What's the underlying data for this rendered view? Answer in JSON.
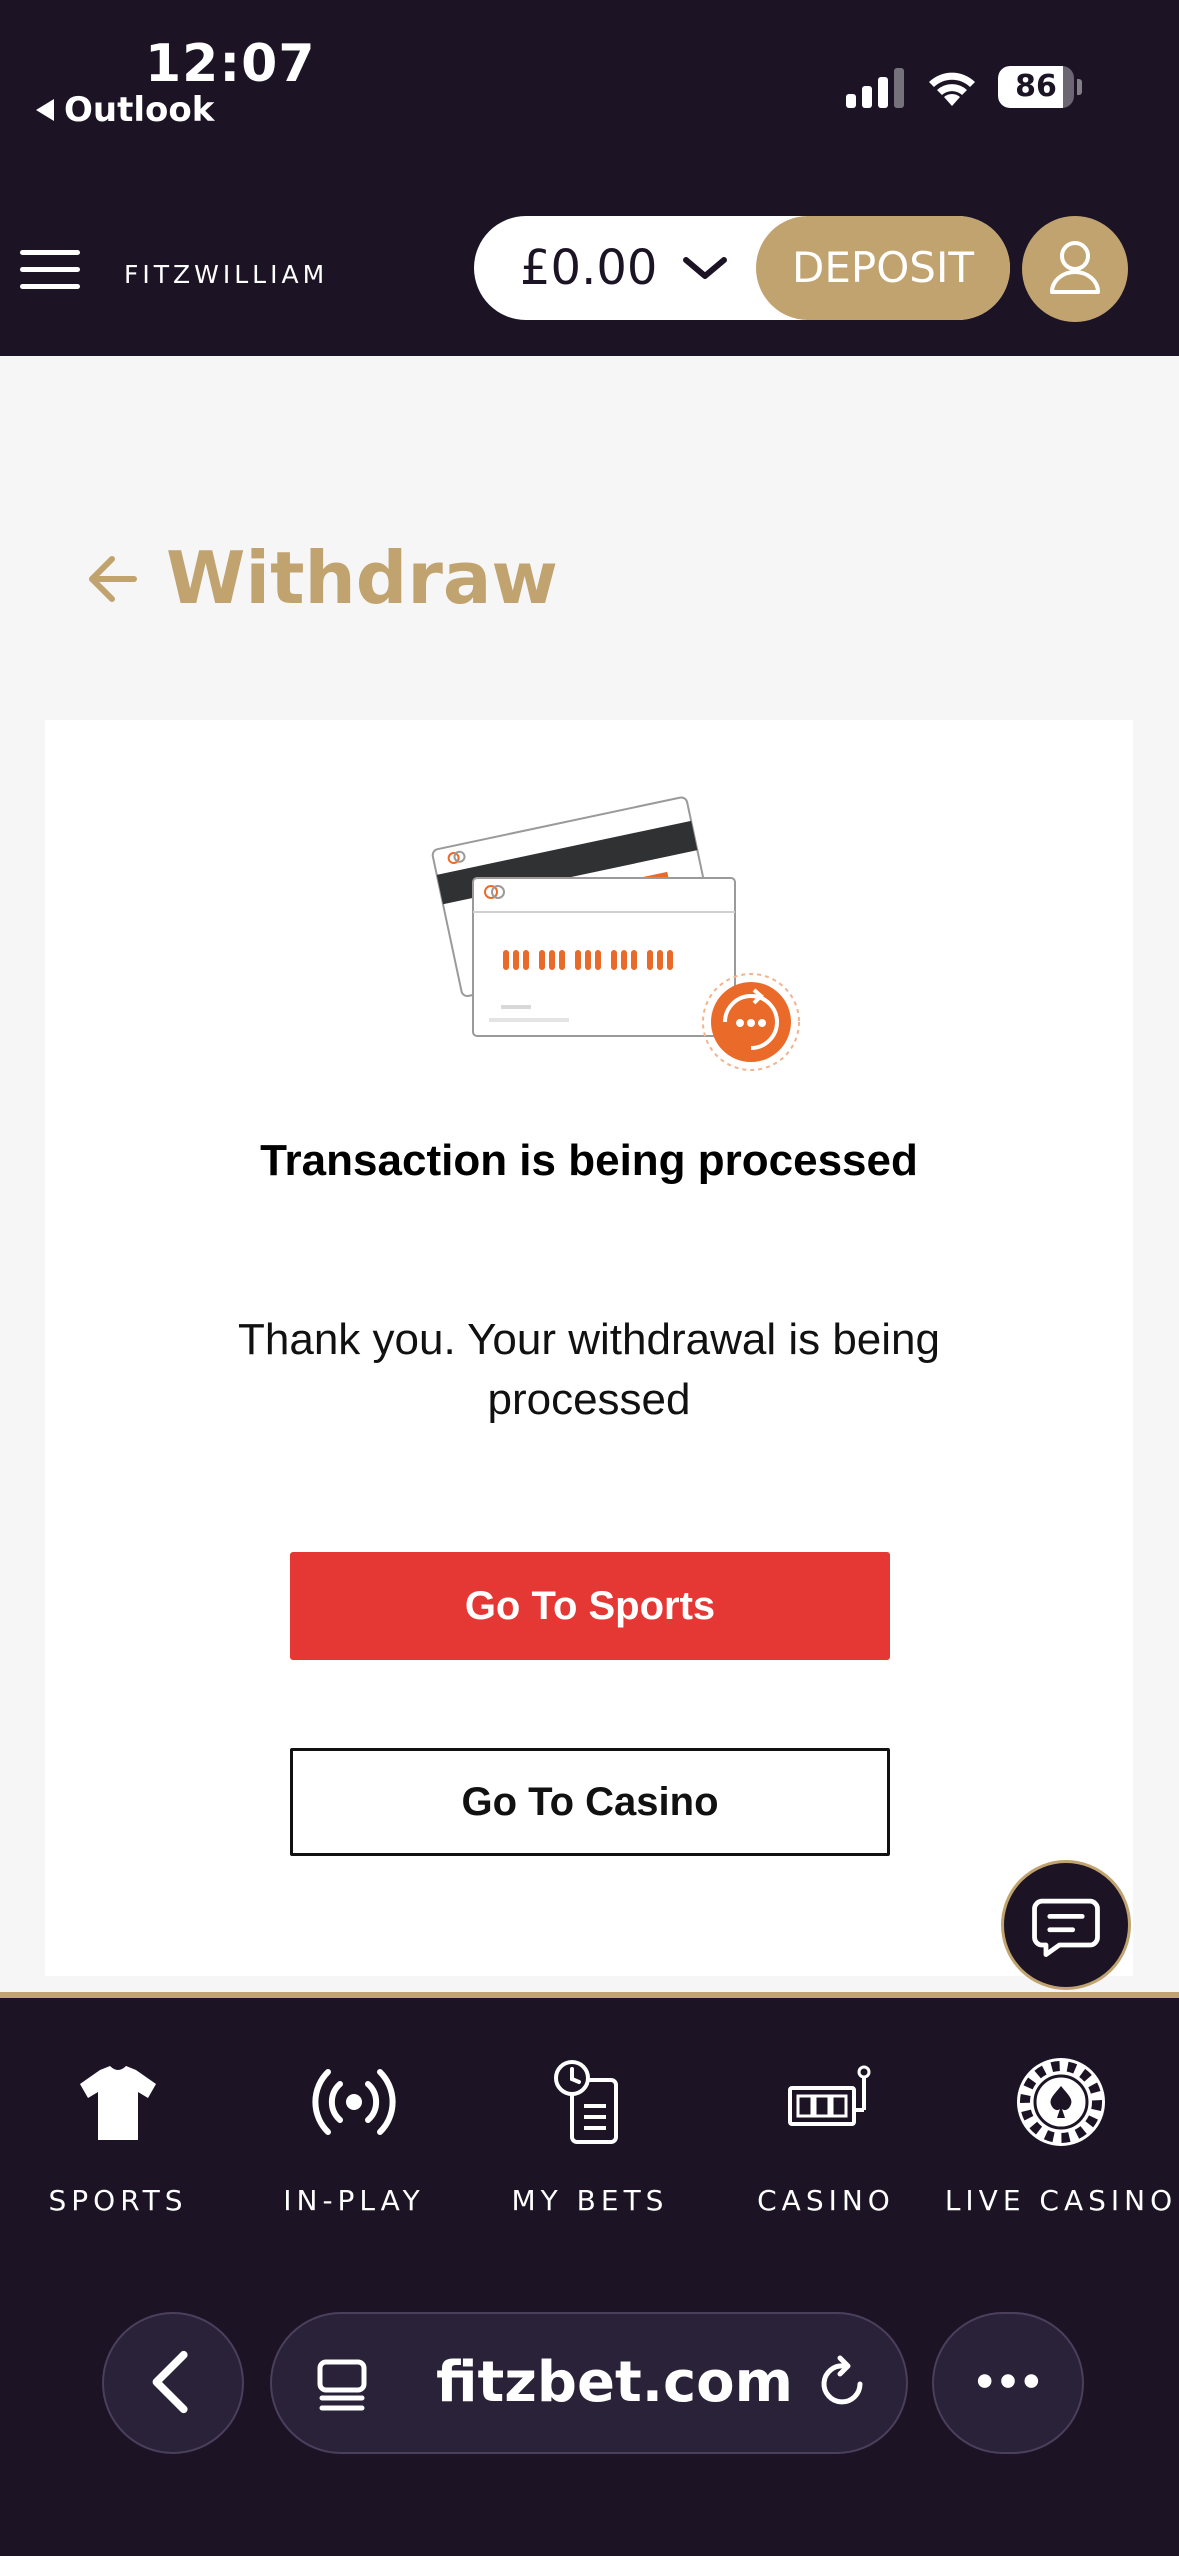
{
  "status_bar": {
    "time": "12:07",
    "back_app": "Outlook",
    "battery": "86",
    "battery_level": 0.86
  },
  "header": {
    "brand": "FITZWILLIAM",
    "balance": "£0.00",
    "deposit_label": "DEPOSIT"
  },
  "page": {
    "title": "Withdraw"
  },
  "card": {
    "status_title": "Transaction is being processed",
    "message": "Thank you. Your withdrawal is being processed",
    "sports_button": "Go To Sports",
    "casino_button": "Go To Casino"
  },
  "bottom_nav": {
    "items": [
      {
        "label": "SPORTS",
        "icon": "shirt-icon"
      },
      {
        "label": "IN-PLAY",
        "icon": "broadcast-icon"
      },
      {
        "label": "MY BETS",
        "icon": "betslip-icon"
      },
      {
        "label": "CASINO",
        "icon": "slot-machine-icon"
      },
      {
        "label": "LIVE CASINO",
        "icon": "roulette-chip-icon"
      }
    ]
  },
  "browser": {
    "url": "fitzbet.com"
  },
  "colors": {
    "dark": "#1c1425",
    "gold": "#c1a36f",
    "red": "#e53834",
    "orange": "#ea6a2a"
  }
}
